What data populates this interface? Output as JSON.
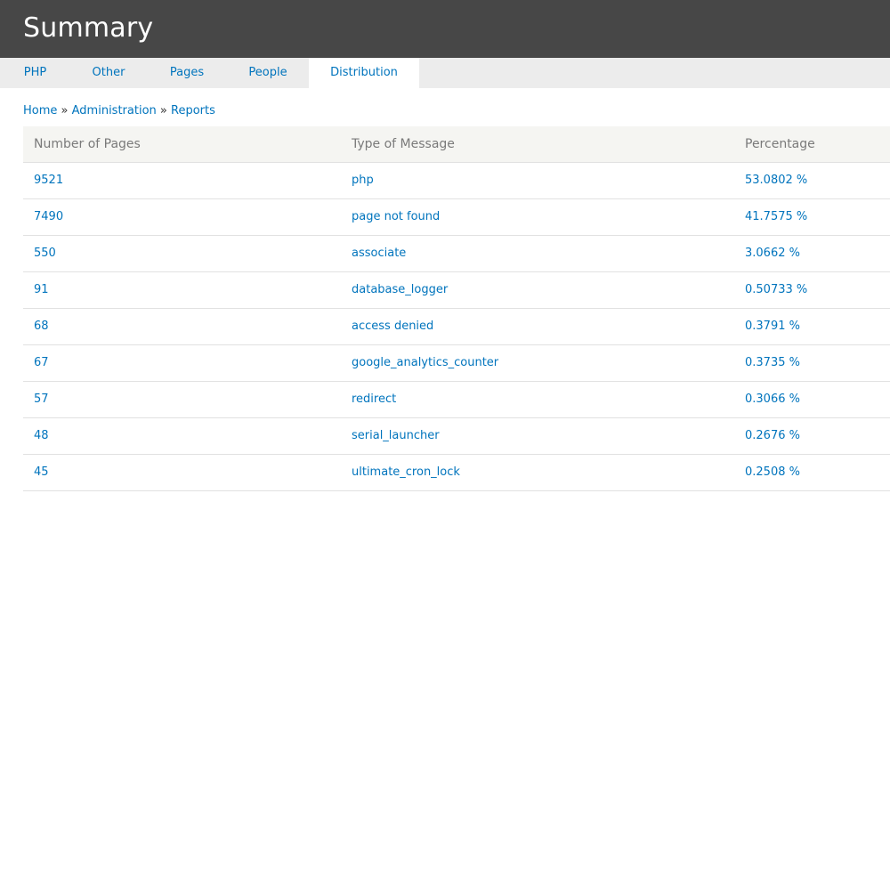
{
  "header": {
    "title": "Summary"
  },
  "tabs": [
    {
      "label": "PHP",
      "active": false
    },
    {
      "label": "Other",
      "active": false
    },
    {
      "label": "Pages",
      "active": false
    },
    {
      "label": "People",
      "active": false
    },
    {
      "label": "Distribution",
      "active": true
    }
  ],
  "breadcrumb": {
    "items": [
      "Home",
      "Administration",
      "Reports"
    ],
    "separator": "»"
  },
  "table": {
    "columns": [
      "Number of Pages",
      "Type of Message",
      "Percentage"
    ],
    "rows": [
      [
        "9521",
        "php",
        "53.0802 %"
      ],
      [
        "7490",
        "page not found",
        "41.7575 %"
      ],
      [
        "550",
        "associate",
        "3.0662 %"
      ],
      [
        "91",
        "database_logger",
        "0.50733 %"
      ],
      [
        "68",
        "access denied",
        "0.3791 %"
      ],
      [
        "67",
        "google_analytics_counter",
        "0.3735 %"
      ],
      [
        "57",
        "redirect",
        "0.3066 %"
      ],
      [
        "48",
        "serial_launcher",
        "0.2676 %"
      ],
      [
        "45",
        "ultimate_cron_lock",
        "0.2508 %"
      ]
    ]
  },
  "colors": {
    "header_bg": "#474747",
    "link": "#0074bd",
    "tabs_bg": "#ececec",
    "table_header_bg": "#f5f5f2"
  }
}
